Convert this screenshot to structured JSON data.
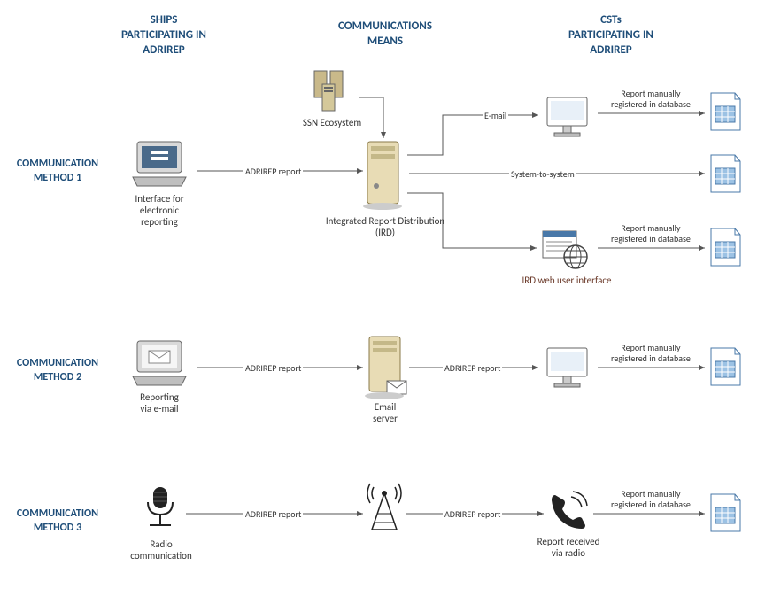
{
  "headers": {
    "ships": "SHIPS\nPARTICIPATING IN\nADRIREP",
    "comms": "COMMUNICATIONS\nMEANS",
    "csts": "CSTs\nPARTICIPATING IN\nADRIREP"
  },
  "methods": {
    "m1": "COMMUNICATION\nMETHOD 1",
    "m2": "COMMUNICATION\nMETHOD 2",
    "m3": "COMMUNICATION\nMETHOD 3"
  },
  "nodes": {
    "interface_reporting": "Interface for\nelectronic\nreporting",
    "ssn": "SSN Ecosystem",
    "ird": "Integrated Report Distribution\n(IRD)",
    "ird_web": "IRD web user interface",
    "reporting_email": "Reporting\nvia e-mail",
    "email_server": "Email\nserver",
    "radio_comm": "Radio\ncommunication",
    "report_via_radio": "Report received\nvia radio"
  },
  "edges": {
    "adrirep_report": "ADRIREP report",
    "email": "E-mail",
    "system_to_system": "System-to-system",
    "manual_register": "Report manually\nregistered in database"
  }
}
